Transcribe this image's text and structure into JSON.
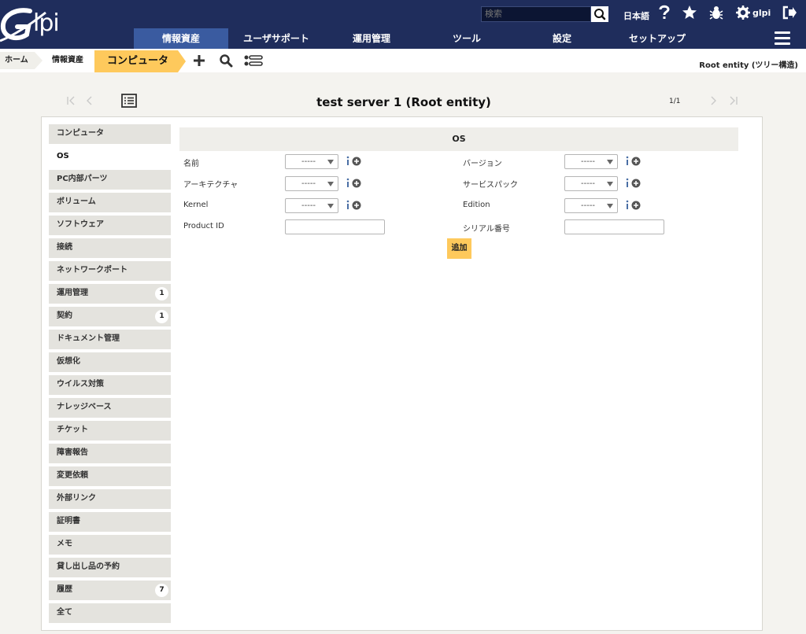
{
  "header": {
    "logo_text": "lpi",
    "search_placeholder": "検索",
    "language": "日本語",
    "user": "glpi"
  },
  "menu": {
    "items": [
      "情報資産",
      "ユーザサポート",
      "運用管理",
      "ツール",
      "設定",
      "セットアップ"
    ]
  },
  "breadcrumb": {
    "home": "ホーム",
    "assets": "情報資産",
    "current": "コンピュータ",
    "entity": "Root entity (ツリー構造)"
  },
  "item": {
    "title": "test server 1 (Root entity)",
    "counter": "1/1"
  },
  "tabs": [
    {
      "label": "コンピュータ",
      "badge": ""
    },
    {
      "label": "OS",
      "badge": ""
    },
    {
      "label": "PC内部パーツ",
      "badge": ""
    },
    {
      "label": "ボリューム",
      "badge": ""
    },
    {
      "label": "ソフトウェア",
      "badge": ""
    },
    {
      "label": "接続",
      "badge": ""
    },
    {
      "label": "ネットワークポート",
      "badge": ""
    },
    {
      "label": "運用管理",
      "badge": "1"
    },
    {
      "label": "契約",
      "badge": "1"
    },
    {
      "label": "ドキュメント管理",
      "badge": ""
    },
    {
      "label": "仮想化",
      "badge": ""
    },
    {
      "label": "ウイルス対策",
      "badge": ""
    },
    {
      "label": "ナレッジベース",
      "badge": ""
    },
    {
      "label": "チケット",
      "badge": ""
    },
    {
      "label": "障害報告",
      "badge": ""
    },
    {
      "label": "変更依頼",
      "badge": ""
    },
    {
      "label": "外部リンク",
      "badge": ""
    },
    {
      "label": "証明書",
      "badge": ""
    },
    {
      "label": "メモ",
      "badge": ""
    },
    {
      "label": "貸し出し品の予約",
      "badge": ""
    },
    {
      "label": "履歴",
      "badge": "7"
    },
    {
      "label": "全て",
      "badge": ""
    }
  ],
  "os_form": {
    "section_title": "OS",
    "name_label": "名前",
    "version_label": "バージョン",
    "arch_label": "アーキテクチャ",
    "servicepack_label": "サービスパック",
    "kernel_label": "Kernel",
    "edition_label": "Edition",
    "productid_label": "Product ID",
    "serial_label": "シリアル番号",
    "empty_option": "-----",
    "productid_value": "",
    "serial_value": "",
    "add_button": "追加"
  },
  "colors": {
    "header_bg": "#1f2d5c",
    "menu_active": "#3a5ba0",
    "accent": "#fec95c"
  }
}
